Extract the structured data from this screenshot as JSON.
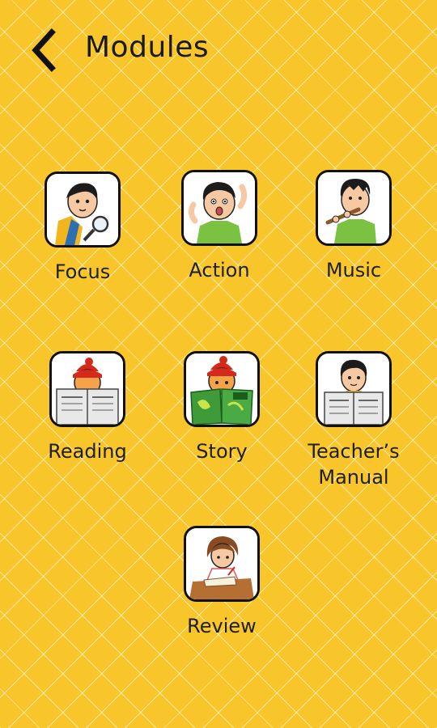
{
  "header": {
    "title": "Modules",
    "back_icon": "chevron-left-icon"
  },
  "modules": [
    {
      "label": "Focus",
      "icon": "boy-magnifying-glass-icon"
    },
    {
      "label": "Action",
      "icon": "boy-gesturing-icon"
    },
    {
      "label": "Music",
      "icon": "boy-playing-flute-icon"
    },
    {
      "label": "Reading",
      "icon": "child-reading-newspaper-icon"
    },
    {
      "label": "Story",
      "icon": "child-reading-storybook-icon"
    },
    {
      "label": "Teacher’s\nManual",
      "icon": "teacher-reading-newspaper-icon"
    },
    {
      "label": "Review",
      "icon": "girl-writing-at-desk-icon"
    }
  ],
  "colors": {
    "background": "#f8c62a",
    "tile_background": "#ffffff",
    "tile_border": "#111111",
    "text": "#1f1f1f"
  }
}
